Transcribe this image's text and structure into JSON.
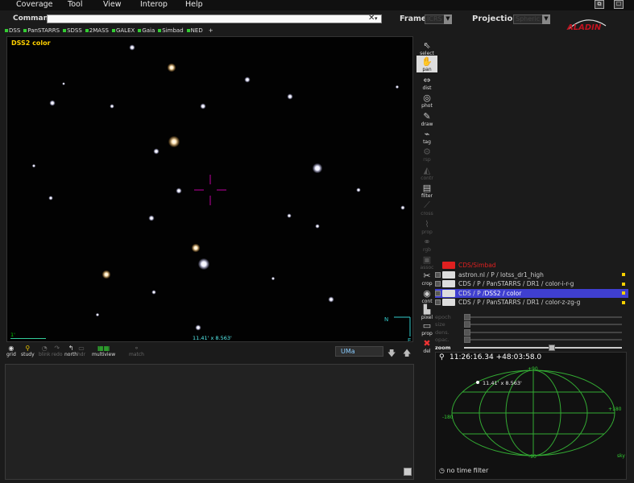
{
  "menu": [
    "Coverage",
    "Tool",
    "View",
    "Interop",
    "Help"
  ],
  "window_controls": {
    "restore": "⧉",
    "maximize": "☐"
  },
  "command": {
    "label": "Command",
    "value": "",
    "clear_glyph": "✕",
    "dropdown_glyph": "▾"
  },
  "frame": {
    "label": "Frame",
    "value": "ICRS"
  },
  "projection": {
    "label": "Projection",
    "value": "Spheric"
  },
  "logo": {
    "text": "ALADIN",
    "color": "#c1121f"
  },
  "shortcuts": [
    "DSS",
    "PanSTARRS",
    "SDSS",
    "2MASS",
    "GALEX",
    "Gaia",
    "Simbad",
    "NED"
  ],
  "shortcut_add": "+",
  "view": {
    "survey_label": "DSS2 color",
    "scale": "1'",
    "fov": "11.41' x 8.563'",
    "compass_n": "N",
    "compass_e": "E"
  },
  "tools": [
    {
      "label": "select",
      "icon": "arrow-icon",
      "enabled": true
    },
    {
      "label": "pan",
      "icon": "hand-icon",
      "enabled": true,
      "active": true
    },
    {
      "label": "dist",
      "icon": "ruler-icon",
      "enabled": true
    },
    {
      "label": "phot",
      "icon": "target-icon",
      "enabled": true
    },
    {
      "label": "draw",
      "icon": "pencil-icon",
      "enabled": true
    },
    {
      "label": "tag",
      "icon": "tag-icon",
      "enabled": true
    },
    {
      "label": "rsp",
      "icon": "rsp-icon",
      "enabled": false
    },
    {
      "label": "contr",
      "icon": "contrast-icon",
      "enabled": false
    },
    {
      "label": "filter",
      "icon": "filter-icon",
      "enabled": true
    },
    {
      "label": "cross",
      "icon": "cross-icon",
      "enabled": false
    },
    {
      "label": "prop",
      "icon": "plot-icon",
      "enabled": false
    },
    {
      "label": "rgb",
      "icon": "rgb-icon",
      "enabled": false
    },
    {
      "label": "assoc",
      "icon": "assoc-icon",
      "enabled": false
    },
    {
      "label": "crop",
      "icon": "crop-icon",
      "enabled": true
    },
    {
      "label": "cont",
      "icon": "contour-icon",
      "enabled": true
    },
    {
      "label": "pixel",
      "icon": "pixel-icon",
      "enabled": true
    },
    {
      "label": "prop",
      "icon": "properties-icon",
      "enabled": true
    },
    {
      "label": "del",
      "icon": "delete-icon",
      "enabled": true
    }
  ],
  "planes": [
    {
      "label_prefix": "",
      "label": "CDS/Simbad",
      "color": "#e02020",
      "checked": false,
      "selected": false,
      "marker": ""
    },
    {
      "label_prefix": "",
      "label": "astron.nl / P / lotss_dr1_high",
      "color": "#cccccc",
      "checked": true,
      "selected": false,
      "marker": "#f5d000"
    },
    {
      "label_prefix": "",
      "label": "CDS / P / PanSTARRS / DR1 / color-i-r-g",
      "color": "#cccccc",
      "checked": true,
      "selected": false,
      "marker": "#f5d000"
    },
    {
      "label_prefix": "CDS / P / ",
      "label": "DSS2 / color",
      "color": "#ffffff",
      "checked": true,
      "selected": true,
      "marker": "#f5d000"
    },
    {
      "label_prefix": "",
      "label": "CDS / P / PanSTARRS / DR1 / color-z-zg-g",
      "color": "#cccccc",
      "checked": true,
      "selected": false,
      "marker": "#f5d000"
    }
  ],
  "plane_props": [
    {
      "label": "epoch",
      "enabled": false
    },
    {
      "label": "size",
      "enabled": false
    },
    {
      "label": "dens.",
      "enabled": false
    },
    {
      "label": "opac.",
      "enabled": false
    },
    {
      "label": "zoom",
      "enabled": true,
      "value": 0.55
    }
  ],
  "bottom_tools": [
    {
      "label": "grid",
      "enabled": true
    },
    {
      "label": "study",
      "enabled": true
    },
    {
      "label": "blink",
      "enabled": false
    },
    {
      "label": "redo",
      "enabled": false
    },
    {
      "label": "north",
      "enabled": true
    },
    {
      "label": "hdr",
      "enabled": false
    },
    {
      "label": "multiview",
      "enabled": true
    },
    {
      "label": "match",
      "enabled": false
    }
  ],
  "target": "UMa",
  "map": {
    "location": "11:26:16.34 +48:03:58.0",
    "fov": "11.41' x 8.563'",
    "labels": [
      "+90",
      "-180",
      "+180",
      "-90"
    ],
    "sky": "sky",
    "time_filter": "no time filter"
  },
  "colors": {
    "accent_green": "#33cc33",
    "selected_plane": "#3f3fd0",
    "survey_label": "#ffd000"
  }
}
